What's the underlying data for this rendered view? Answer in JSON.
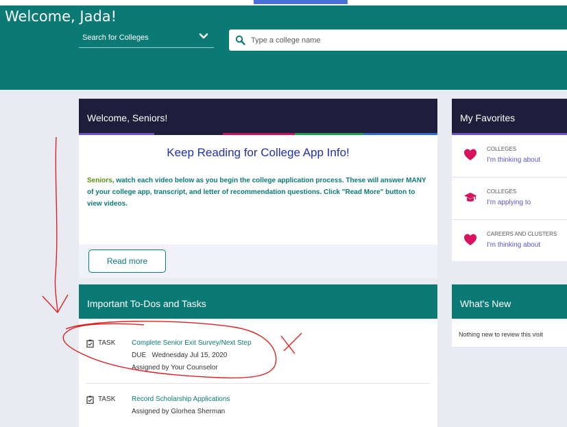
{
  "header": {
    "welcome": "Welcome, Jada!",
    "search_mode": "Search for Colleges",
    "search_placeholder": "Type a college name"
  },
  "welcome_card": {
    "title": "Welcome, Seniors!",
    "headline": "Keep Reading for College App Info!",
    "body_highlight": "Seniors",
    "body_rest": ", watch each video below as you begin the college application process. These will answer MANY of your college app, transcript, and letter of recommendation questions. Click \"Read More\" button to view videos.",
    "read_more": "Read more"
  },
  "favorites": {
    "title": "My Favorites",
    "items": [
      {
        "icon": "heart-icon",
        "category": "COLLEGES",
        "link": "I'm thinking about"
      },
      {
        "icon": "graduation-cap-icon",
        "category": "COLLEGES",
        "link": "I'm applying to"
      },
      {
        "icon": "heart-icon",
        "category": "CAREERS AND CLUSTERS",
        "link": "I'm thinking about"
      }
    ]
  },
  "todos": {
    "title": "Important To-Dos and Tasks",
    "tasks": [
      {
        "type": "TASK",
        "title": "Complete Senior Exit Survey/Next Step",
        "due": "DUE   Wednesday Jul 15, 2020",
        "assigned": "Assigned by Your Counselor"
      },
      {
        "type": "TASK",
        "title": "Record Scholarship Applications",
        "assigned": "Assigned by Glorhea Sherman"
      }
    ]
  },
  "whats_new": {
    "title": "What's New",
    "empty": "Nothing new to review this visit"
  },
  "colors": {
    "teal": "#0b7a75",
    "navy": "#1e1e3c",
    "pink": "#d8135e",
    "purple_link": "#5a55c8",
    "annotation_red": "#e02020"
  }
}
